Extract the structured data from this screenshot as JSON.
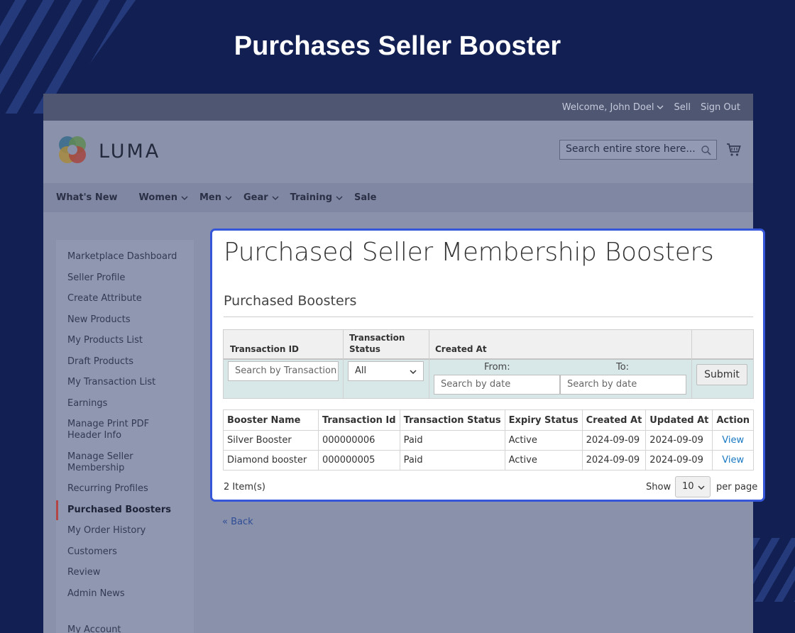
{
  "banner": {
    "title": "Purchases Seller Booster"
  },
  "store": {
    "topbar": {
      "welcome": "Welcome, John Doel",
      "sell": "Sell",
      "signout": "Sign Out"
    },
    "logo_text": "LUMA",
    "search_placeholder": "Search entire store here...",
    "nav": [
      "What's New",
      "Women",
      "Men",
      "Gear",
      "Training",
      "Sale"
    ],
    "sidebar": [
      "Marketplace Dashboard",
      "Seller Profile",
      "Create Attribute",
      "New Products",
      "My Products List",
      "Draft Products",
      "My Transaction List",
      "Earnings",
      "Manage Print PDF Header Info",
      "Manage Seller Membership",
      "Recurring Profiles",
      "Purchased Boosters",
      "My Order History",
      "Customers",
      "Review",
      "Admin News",
      "My Account"
    ],
    "sidebar_active": "Purchased Boosters",
    "back_link": "« Back"
  },
  "card": {
    "title": "Purchased Seller Membership Boosters",
    "section_title": "Purchased Boosters",
    "filter": {
      "col_transaction_id": "Transaction ID",
      "col_transaction_status_1": "Transaction",
      "col_transaction_status_2": "Status",
      "col_created_at": "Created At",
      "transaction_placeholder": "Search by Transaction I",
      "status_value": "All",
      "from_label": "From:",
      "to_label": "To:",
      "from_placeholder": "Search by date",
      "to_placeholder": "Search by date",
      "submit": "Submit"
    },
    "table": {
      "headers": [
        "Booster Name",
        "Transaction Id",
        "Transaction Status",
        "Expiry Status",
        "Created At",
        "Updated At",
        "Action"
      ],
      "rows": [
        [
          "Silver Booster",
          "000000006",
          "Paid",
          "Active",
          "2024-09-09",
          "2024-09-09",
          "View"
        ],
        [
          "Diamond booster",
          "000000005",
          "Paid",
          "Active",
          "2024-09-09",
          "2024-09-09",
          "View"
        ]
      ]
    },
    "pager": {
      "items": "2 Item(s)",
      "show": "Show",
      "per_page_value": "10",
      "per_page": "per page"
    }
  },
  "colors": {
    "background": "#121f52",
    "highlight_border": "#3556d8",
    "link": "#1979c3"
  }
}
